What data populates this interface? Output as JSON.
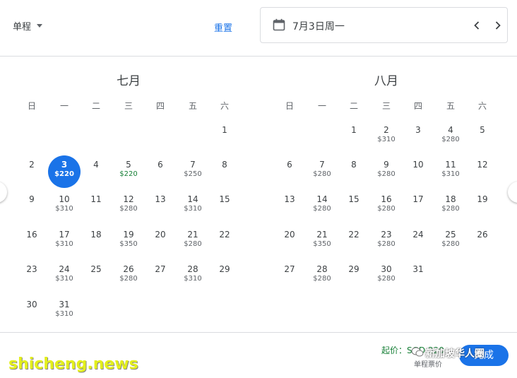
{
  "header": {
    "trip_type": "单程",
    "reset": "重置",
    "date_label": "7月3日周一"
  },
  "weekdays": [
    "日",
    "一",
    "二",
    "三",
    "四",
    "五",
    "六"
  ],
  "months": [
    {
      "title": "七月",
      "days": [
        {
          "d": "1",
          "p": ""
        },
        {
          "d": "2",
          "p": ""
        },
        {
          "d": "3",
          "p": "$220",
          "selected": true
        },
        {
          "d": "4",
          "p": ""
        },
        {
          "d": "5",
          "p": "$220",
          "green": true
        },
        {
          "d": "6",
          "p": ""
        },
        {
          "d": "7",
          "p": "$250"
        },
        {
          "d": "8",
          "p": ""
        },
        {
          "d": "9",
          "p": ""
        },
        {
          "d": "10",
          "p": "$310"
        },
        {
          "d": "11",
          "p": ""
        },
        {
          "d": "12",
          "p": "$280"
        },
        {
          "d": "13",
          "p": ""
        },
        {
          "d": "14",
          "p": "$310"
        },
        {
          "d": "15",
          "p": ""
        },
        {
          "d": "16",
          "p": ""
        },
        {
          "d": "17",
          "p": "$310"
        },
        {
          "d": "18",
          "p": ""
        },
        {
          "d": "19",
          "p": "$350"
        },
        {
          "d": "20",
          "p": ""
        },
        {
          "d": "21",
          "p": "$280"
        },
        {
          "d": "22",
          "p": ""
        },
        {
          "d": "23",
          "p": ""
        },
        {
          "d": "24",
          "p": "$310"
        },
        {
          "d": "25",
          "p": ""
        },
        {
          "d": "26",
          "p": "$280"
        },
        {
          "d": "27",
          "p": ""
        },
        {
          "d": "28",
          "p": "$310"
        },
        {
          "d": "29",
          "p": ""
        },
        {
          "d": "30",
          "p": ""
        },
        {
          "d": "31",
          "p": "$310"
        }
      ]
    },
    {
      "title": "八月",
      "days": [
        {
          "d": "1",
          "p": ""
        },
        {
          "d": "2",
          "p": "$310"
        },
        {
          "d": "3",
          "p": ""
        },
        {
          "d": "4",
          "p": "$280"
        },
        {
          "d": "5",
          "p": ""
        },
        {
          "d": "6",
          "p": ""
        },
        {
          "d": "7",
          "p": "$280"
        },
        {
          "d": "8",
          "p": ""
        },
        {
          "d": "9",
          "p": "$280"
        },
        {
          "d": "10",
          "p": ""
        },
        {
          "d": "11",
          "p": "$310"
        },
        {
          "d": "12",
          "p": ""
        },
        {
          "d": "13",
          "p": ""
        },
        {
          "d": "14",
          "p": "$280"
        },
        {
          "d": "15",
          "p": ""
        },
        {
          "d": "16",
          "p": "$280"
        },
        {
          "d": "17",
          "p": ""
        },
        {
          "d": "18",
          "p": "$280"
        },
        {
          "d": "19",
          "p": ""
        },
        {
          "d": "20",
          "p": ""
        },
        {
          "d": "21",
          "p": "$350"
        },
        {
          "d": "22",
          "p": ""
        },
        {
          "d": "23",
          "p": "$280"
        },
        {
          "d": "24",
          "p": ""
        },
        {
          "d": "25",
          "p": "$280"
        },
        {
          "d": "26",
          "p": ""
        },
        {
          "d": "27",
          "p": ""
        },
        {
          "d": "28",
          "p": "$280"
        },
        {
          "d": "29",
          "p": ""
        },
        {
          "d": "30",
          "p": "$280"
        },
        {
          "d": "31",
          "p": ""
        }
      ]
    }
  ],
  "footer": {
    "price_info": "起价：SGD 220",
    "price_sub": "单程票价",
    "done": "完成",
    "watermark": "shicheng.news",
    "wechat_overlay": "新加坡华人圈"
  },
  "colors": {
    "accent": "#1a73e8",
    "low_price": "#188038"
  }
}
